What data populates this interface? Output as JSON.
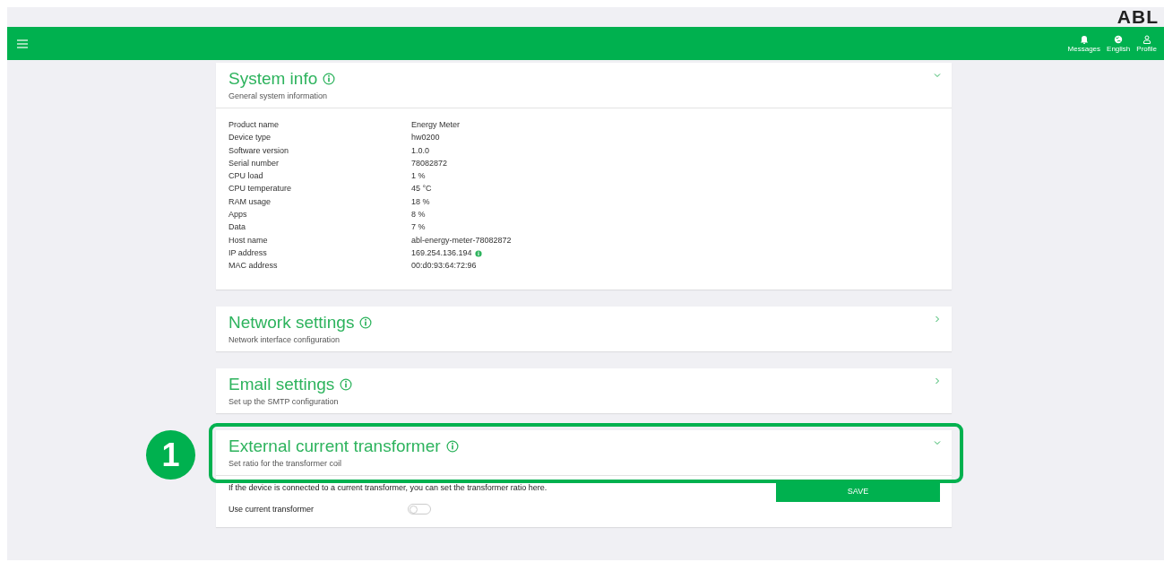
{
  "logo": "ABL",
  "header": {
    "actions": [
      {
        "kind": "bell",
        "label": "Messages"
      },
      {
        "kind": "globe",
        "label": "English"
      },
      {
        "kind": "person",
        "label": "Profile"
      }
    ]
  },
  "sections": [
    {
      "kind": "info",
      "title": "System info",
      "subtitle": "General system information",
      "expanded": true,
      "highlighted": false,
      "rows": [
        {
          "label": "Product name",
          "value": "Energy Meter",
          "info_badge": false
        },
        {
          "label": "Device type",
          "value": "hw0200",
          "info_badge": false
        },
        {
          "label": "Software version",
          "value": "1.0.0",
          "info_badge": false
        },
        {
          "label": "Serial number",
          "value": "78082872",
          "info_badge": false
        },
        {
          "label": "CPU load",
          "value": "1 %",
          "info_badge": false
        },
        {
          "label": "CPU temperature",
          "value": "45 °C",
          "info_badge": false
        },
        {
          "label": "RAM usage",
          "value": "18 %",
          "info_badge": false
        },
        {
          "label": "Apps",
          "value": "8 %",
          "info_badge": false
        },
        {
          "label": "Data",
          "value": "7 %",
          "info_badge": false
        },
        {
          "label": "Host name",
          "value": "abl-energy-meter-78082872",
          "info_badge": false
        },
        {
          "label": "IP address",
          "value": "169.254.136.194",
          "info_badge": true
        },
        {
          "label": "MAC address",
          "value": "00:d0:93:64:72:96",
          "info_badge": false
        }
      ]
    },
    {
      "title": "Network settings",
      "subtitle": "Network interface configuration",
      "expanded": false,
      "highlighted": false
    },
    {
      "title": "Email settings",
      "subtitle": "Set up the SMTP configuration",
      "expanded": false,
      "highlighted": false
    },
    {
      "kind": "transformer",
      "title": "External current transformer",
      "subtitle": "Set ratio for the transformer coil",
      "expanded": true,
      "highlighted": true,
      "callout": "1",
      "description": "If the device is connected to a current transformer, you can set the transformer ratio here.",
      "save_label": "SAVE",
      "toggle": {
        "label": "Use current transformer",
        "on": false
      }
    }
  ]
}
